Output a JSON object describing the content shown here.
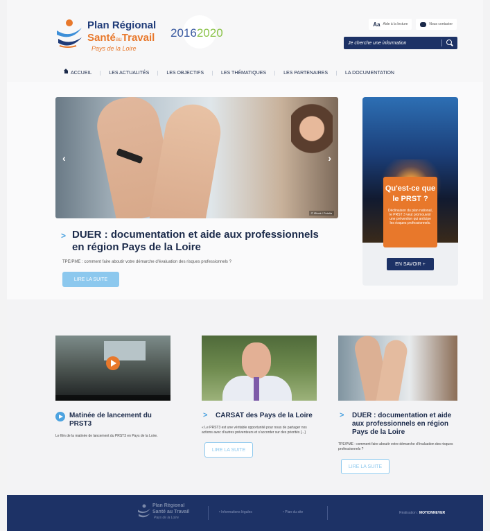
{
  "header": {
    "logo": {
      "line1": "Plan Régional",
      "line2_main": "Santé",
      "line2_small": "au",
      "line2_end": "Travail",
      "line3": "Pays de la Loire"
    },
    "years_start": "2016",
    "years_end": "2020",
    "util": {
      "reading_aid_icon": "Aa",
      "reading_aid": "Aide à la lecture",
      "contact": "Nous contacter"
    },
    "search": {
      "placeholder": "Je cherche une information"
    }
  },
  "nav": {
    "items": [
      {
        "label": "ACCUEIL"
      },
      {
        "label": "LES ACTUALITÉS"
      },
      {
        "label": "LES OBJECTIFS"
      },
      {
        "label": "LES THÉMATIQUES"
      },
      {
        "label": "LES PARTENAIRES"
      },
      {
        "label": "LA DOCUMENTATION"
      }
    ]
  },
  "hero": {
    "credit": "© iStock / Fotolia",
    "arrow_left": "‹",
    "arrow_right": "›",
    "chevron": ">",
    "title": "DUER : documentation et aide aux professionnels en région Pays de la Loire",
    "description": "TPE/PME : comment faire aboutir votre démarche d'évaluation des risques professionnels ?",
    "button": "LIRE LA SUITE"
  },
  "promo": {
    "title_line1": "Qu'est-ce que",
    "title_line2": "le PRST ?",
    "text": "Déclinaison du plan national, le PRST 3 veut promouvoir une prévention qui anticipe les risques professionnels.",
    "button": "EN SAVOIR +"
  },
  "cards": [
    {
      "title": "Matinée de lancement du PRST3",
      "text": "Le film de la matinée de lancement du PRST3 en Pays de la Loire."
    },
    {
      "chevron": ">",
      "title": "CARSAT des Pays de la Loire",
      "text": "« Le PRST3 est une véritable opportunité pour nous de partager nos actions avec d'autres préventeurs et s'accorder sur des priorités [...]",
      "button": "LIRE LA SUITE"
    },
    {
      "chevron": ">",
      "title": "DUER : documentation et aide aux professionnels en région Pays de la Loire",
      "text": "TPE/PME : comment faire aboutir votre démarche d'évaluation des risques professionnels ?",
      "button": "LIRE LA SUITE"
    }
  ],
  "footer": {
    "logo_line1": "Plan Régional",
    "logo_line2": "Santé au Travail",
    "logo_line3": "Pays de la Loire",
    "legal": "Informations légales",
    "sitemap": "Plan du site",
    "credit_label": "Réalisation :",
    "credit_brand": "MOTIONNEVER"
  },
  "colors": {
    "navy": "#1d3266",
    "orange": "#e8782b",
    "light_blue": "#8cc8ee",
    "accent_blue": "#4da3e0"
  }
}
